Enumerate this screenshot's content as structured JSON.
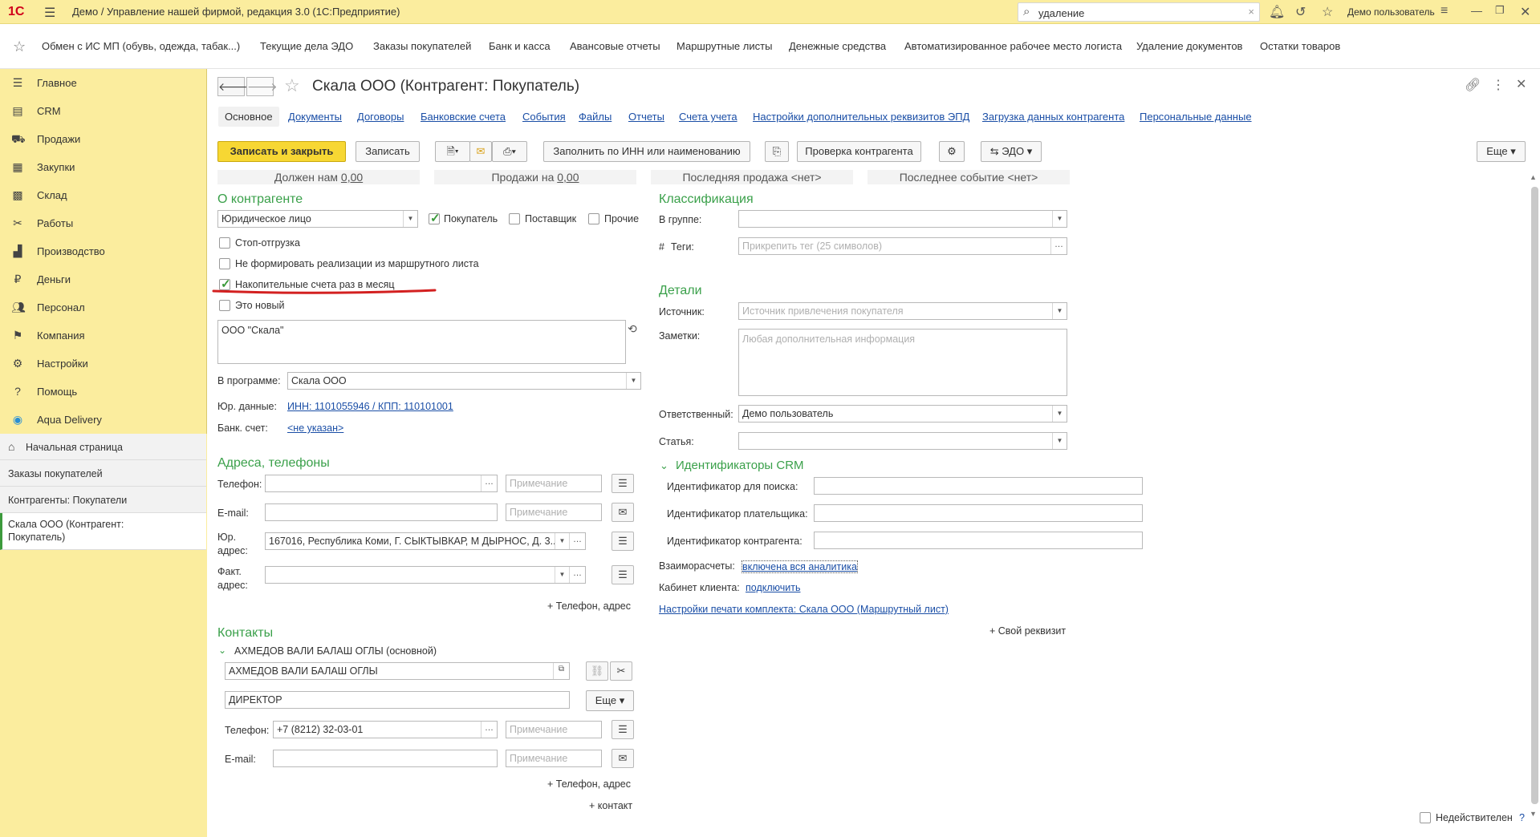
{
  "titlebar": {
    "logo": "1C",
    "title": "Демо / Управление нашей фирмой, редакция 3.0  (1С:Предприятие)",
    "search_value": "удаление",
    "user": "Демо пользователь"
  },
  "favorites": [
    "Обмен с ИС МП (обувь, одежда, табак...)",
    "Текущие дела ЭДО",
    "Заказы покупателей",
    "Банк и касса",
    "Авансовые отчеты",
    "Маршрутные листы",
    "Денежные средства",
    "Автоматизированное рабочее место логиста",
    "Удаление документов",
    "Остатки товаров"
  ],
  "sidebar": {
    "items": [
      {
        "label": "Главное",
        "icon": "menu-lines-icon"
      },
      {
        "label": "CRM",
        "icon": "crm-icon"
      },
      {
        "label": "Продажи",
        "icon": "cart-icon"
      },
      {
        "label": "Закупки",
        "icon": "purchases-icon"
      },
      {
        "label": "Склад",
        "icon": "warehouse-icon"
      },
      {
        "label": "Работы",
        "icon": "tools-icon"
      },
      {
        "label": "Производство",
        "icon": "factory-icon"
      },
      {
        "label": "Деньги",
        "icon": "money-icon"
      },
      {
        "label": "Персонал",
        "icon": "people-icon"
      },
      {
        "label": "Компания",
        "icon": "flag-icon"
      },
      {
        "label": "Настройки",
        "icon": "gear-icon"
      },
      {
        "label": "Помощь",
        "icon": "help-icon"
      },
      {
        "label": "Aqua Delivery",
        "icon": "drop-icon"
      }
    ],
    "open_windows": [
      "Начальная страница",
      "Заказы покупателей",
      "Контрагенты: Покупатели",
      "Скала ООО (Контрагент: Покупатель)"
    ]
  },
  "form": {
    "title": "Скала ООО (Контрагент: Покупатель)",
    "tabs": [
      "Основное",
      "Документы",
      "Договоры",
      "Банковские счета",
      "События",
      "Файлы",
      "Отчеты",
      "Счета учета",
      "Настройки дополнительных реквизитов ЭПД",
      "Загрузка данных контрагента",
      "Персональные данные"
    ],
    "toolbar": {
      "save_close": "Записать и закрыть",
      "save": "Записать",
      "fill_inn": "Заполнить по ИНН или наименованию",
      "check": "Проверка контрагента",
      "edo": "ЭДО",
      "more": "Еще"
    },
    "summary": {
      "owes_label": "Должен нам",
      "owes_value": "0,00",
      "sales_label": "Продажи на",
      "sales_value": "0,00",
      "last_sale": "Последняя продажа <нет>",
      "last_event": "Последнее событие <нет>"
    },
    "about": {
      "heading": "О контрагенте",
      "type": "Юридическое лицо",
      "buyer": "Покупатель",
      "supplier": "Поставщик",
      "other": "Прочие",
      "stop_shipping": "Стоп-отгрузка",
      "no_realization": "Не формировать реализации из маршрутного листа",
      "accumulative": "Накопительные счета раз в месяц",
      "is_new": "Это новый",
      "full_name": "ООО \"Скала\"",
      "in_program_label": "В программе:",
      "in_program_value": "Скала ООО",
      "legal_label": "Юр. данные:",
      "legal_value": "ИНН: 1101055946 / КПП: 110101001",
      "bank_label": "Банк. счет:",
      "bank_value": "<не указан>"
    },
    "addresses": {
      "heading": "Адреса, телефоны",
      "phone_label": "Телефон:",
      "email_label": "E-mail:",
      "legal_addr_label1": "Юр.",
      "legal_addr_label2": "адрес:",
      "legal_addr_value": "167016, Республика Коми, Г. СЫКТЫВКАР, М ДЫРНОС, Д. 3...",
      "fact_addr_label1": "Факт.",
      "fact_addr_label2": "адрес:",
      "note_placeholder": "Примечание",
      "add_phone": "+ Телефон, адрес"
    },
    "contacts": {
      "heading": "Контакты",
      "main_contact": "АХМЕДОВ ВАЛИ БАЛАШ ОГЛЫ (основной)",
      "name": "АХМЕДОВ ВАЛИ БАЛАШ ОГЛЫ",
      "position": "ДИРЕКТОР",
      "more": "Еще",
      "phone_label": "Телефон:",
      "phone_value": "+7 (8212) 32-03-01",
      "email_label": "E-mail:",
      "note_placeholder": "Примечание",
      "add_phone": "+ Телефон, адрес",
      "add_contact": "+ контакт"
    },
    "classification": {
      "heading": "Классификация",
      "group_label": "В группе:",
      "tags_label": "Теги:",
      "tags_hash": "#",
      "tags_placeholder": "Прикрепить тег (25 символов)"
    },
    "details": {
      "heading": "Детали",
      "source_label": "Источник:",
      "source_placeholder": "Источник привлечения покупателя",
      "notes_label": "Заметки:",
      "notes_placeholder": "Любая дополнительная информация",
      "responsible_label": "Ответственный:",
      "responsible_value": "Демо пользователь",
      "article_label": "Статья:"
    },
    "crm": {
      "heading": "Идентификаторы CRM",
      "search_id": "Идентификатор для поиска:",
      "payer_id": "Идентификатор плательщика:",
      "counterparty_id": "Идентификатор контрагента:",
      "settlements_label": "Взаиморасчеты:",
      "settlements_value": "включена вся аналитика",
      "cabinet_label": "Кабинет клиента:",
      "cabinet_value": "подключить",
      "print_settings": "Настройки печати комплекта: Скала ООО (Маршрутный лист)",
      "custom_attr": "+ Свой реквизит"
    },
    "inactive": "Недействителен",
    "help_mark": "?"
  },
  "colors": {
    "accent_yellow": "#fbed9e",
    "primary_button": "#f7d733",
    "section_green": "#3aa04a",
    "link_blue": "#1a4ea6",
    "annotation_red": "#d32020"
  }
}
